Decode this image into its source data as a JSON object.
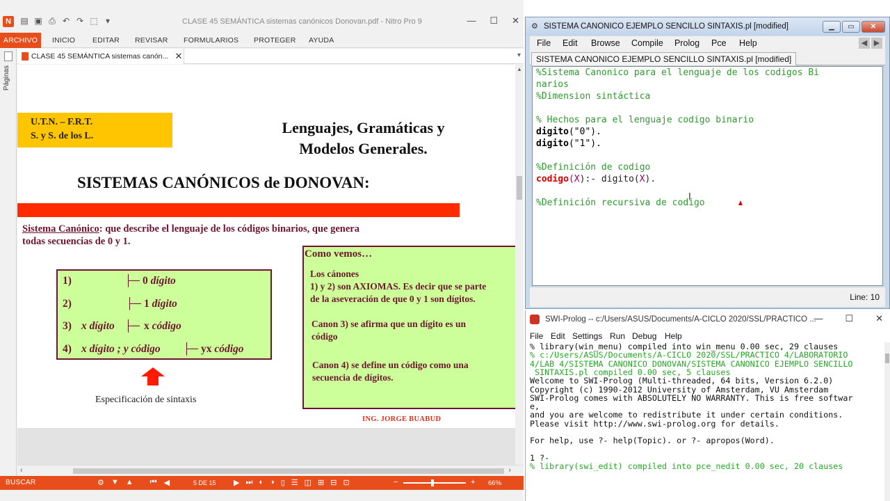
{
  "nitro": {
    "title": "CLASE 45 SEMÁNTICA sistemas canónicos Donovan.pdf - Nitro Pro 9",
    "ribbon_tabs": [
      "ARCHIVO",
      "INICIO",
      "EDITAR",
      "REVISAR",
      "FORMULARIOS",
      "PROTEGER",
      "AYUDA"
    ],
    "side_panel_label": "Páginas",
    "doc_tab_title": "CLASE 45 SEMÁNTICA sistemas canón...",
    "status": {
      "search_label": "BUSCAR",
      "page_indicator": "5 DE 15",
      "zoom": "66%"
    },
    "accent_color": "#e84e1b"
  },
  "pdf": {
    "header_box": [
      "U.T.N. – F.R.T.",
      "S. y S. de los L."
    ],
    "heading1_lines": [
      "Lenguajes, Gramáticas y",
      "Modelos Generales."
    ],
    "heading2": "SISTEMAS CANÓNICOS de DONOVAN:",
    "intro_underlined": "Sistema Canónico",
    "intro_rest": ": que describe el lenguaje de los códigos binarios, que genera todas secuencias de 0 y 1.",
    "rules": [
      {
        "num": "1)",
        "left": "",
        "right_plain": "0 ",
        "right_italic": "dígito"
      },
      {
        "num": "2)",
        "left": "",
        "right_plain": "1 ",
        "right_italic": "dígito"
      },
      {
        "num": "3)",
        "left": "x dígito",
        "right_plain": "x ",
        "right_italic": "código"
      },
      {
        "num": "4)",
        "left": "x dígito ;  y código",
        "right_plain": "yx ",
        "right_italic": "código"
      }
    ],
    "turnstile": "├─",
    "spec_caption": "Especificación de sintaxis",
    "como_vemos_title": "Como vemos…",
    "como_vemos_p1": [
      "Los cánones",
      "1) y 2) son AXIOMAS. Es decir que se parte",
      "de la aseveración de que 0 y 1 son dígitos."
    ],
    "como_vemos_p2": [
      "Canon 3) se afirma que un dígito es un",
      "código"
    ],
    "como_vemos_p3": [
      "Canon 4) se define un código como una",
      "secuencia de dígitos."
    ],
    "author": "ING. JORGE BUABUD"
  },
  "editor": {
    "title": "SISTEMA CANONICO EJEMPLO SENCILLO SINTAXIS.pl [modified]",
    "menu": [
      "File",
      "Edit",
      "Browse",
      "Compile",
      "Prolog",
      "Pce",
      "Help"
    ],
    "tab_label": "SISTEMA CANONICO EJEMPLO SENCILLO SINTAXIS.pl [modified]",
    "code": {
      "l1": "%Sistema Canonico para el lenguaje de los codigos Bi",
      "l2": "narios",
      "l3": "%Dimension sintáctica",
      "l5": "% Hechos para el lenguaje codigo binario",
      "l6_pred": "digito",
      "l6_rest": "(\"0\").",
      "l7_pred": "digito",
      "l7_rest": "(\"1\").",
      "l9": "%Definición de codigo",
      "l10_head": "codigo",
      "l10_open": "(",
      "l10_var": "X",
      "l10_mid": "):- digito(",
      "l10_var2": "X",
      "l10_end": ").",
      "l12": "%Definición recursiva de codigo"
    },
    "status_line": "Line: 10"
  },
  "console": {
    "title": "SWI-Prolog -- c:/Users/ASUS/Documents/A-CICLO 2020/SSL/PRACTICO ...",
    "menu": [
      "File",
      "Edit",
      "Settings",
      "Run",
      "Debug",
      "Help"
    ],
    "lines": [
      {
        "text": "% library(win_menu) compiled into win_menu 0.00 sec, 29 clauses",
        "color": "black"
      },
      {
        "text": "% c:/Users/ASUS/Documents/A-CICLO 2020/SSL/PRACTICO 4/LABORATORIO",
        "color": "green"
      },
      {
        "text": "4/LAB 4/SISTEMA CANONICO DONOVAN/SISTEMA CANONICO EJEMPLO SENCILLO",
        "color": "green"
      },
      {
        "text": " SINTAXIS.pl compiled 0.00 sec, 5 clauses",
        "color": "green"
      },
      {
        "text": "Welcome to SWI-Prolog (Multi-threaded, 64 bits, Version 6.2.0)",
        "color": "black"
      },
      {
        "text": "Copyright (c) 1990-2012 University of Amsterdam, VU Amsterdam",
        "color": "black"
      },
      {
        "text": "SWI-Prolog comes with ABSOLUTELY NO WARRANTY. This is free softwar",
        "color": "black"
      },
      {
        "text": "e,",
        "color": "black"
      },
      {
        "text": "and you are welcome to redistribute it under certain conditions.",
        "color": "black"
      },
      {
        "text": "Please visit http://www.swi-prolog.org for details.",
        "color": "black"
      },
      {
        "text": "",
        "color": "black"
      },
      {
        "text": "For help, use ?- help(Topic). or ?- apropos(Word).",
        "color": "black"
      },
      {
        "text": "",
        "color": "black"
      },
      {
        "text": "1 ?-",
        "color": "black"
      },
      {
        "text": "% library(swi_edit) compiled into pce_nedit 0.00 sec, 20 clauses",
        "color": "green"
      }
    ]
  }
}
